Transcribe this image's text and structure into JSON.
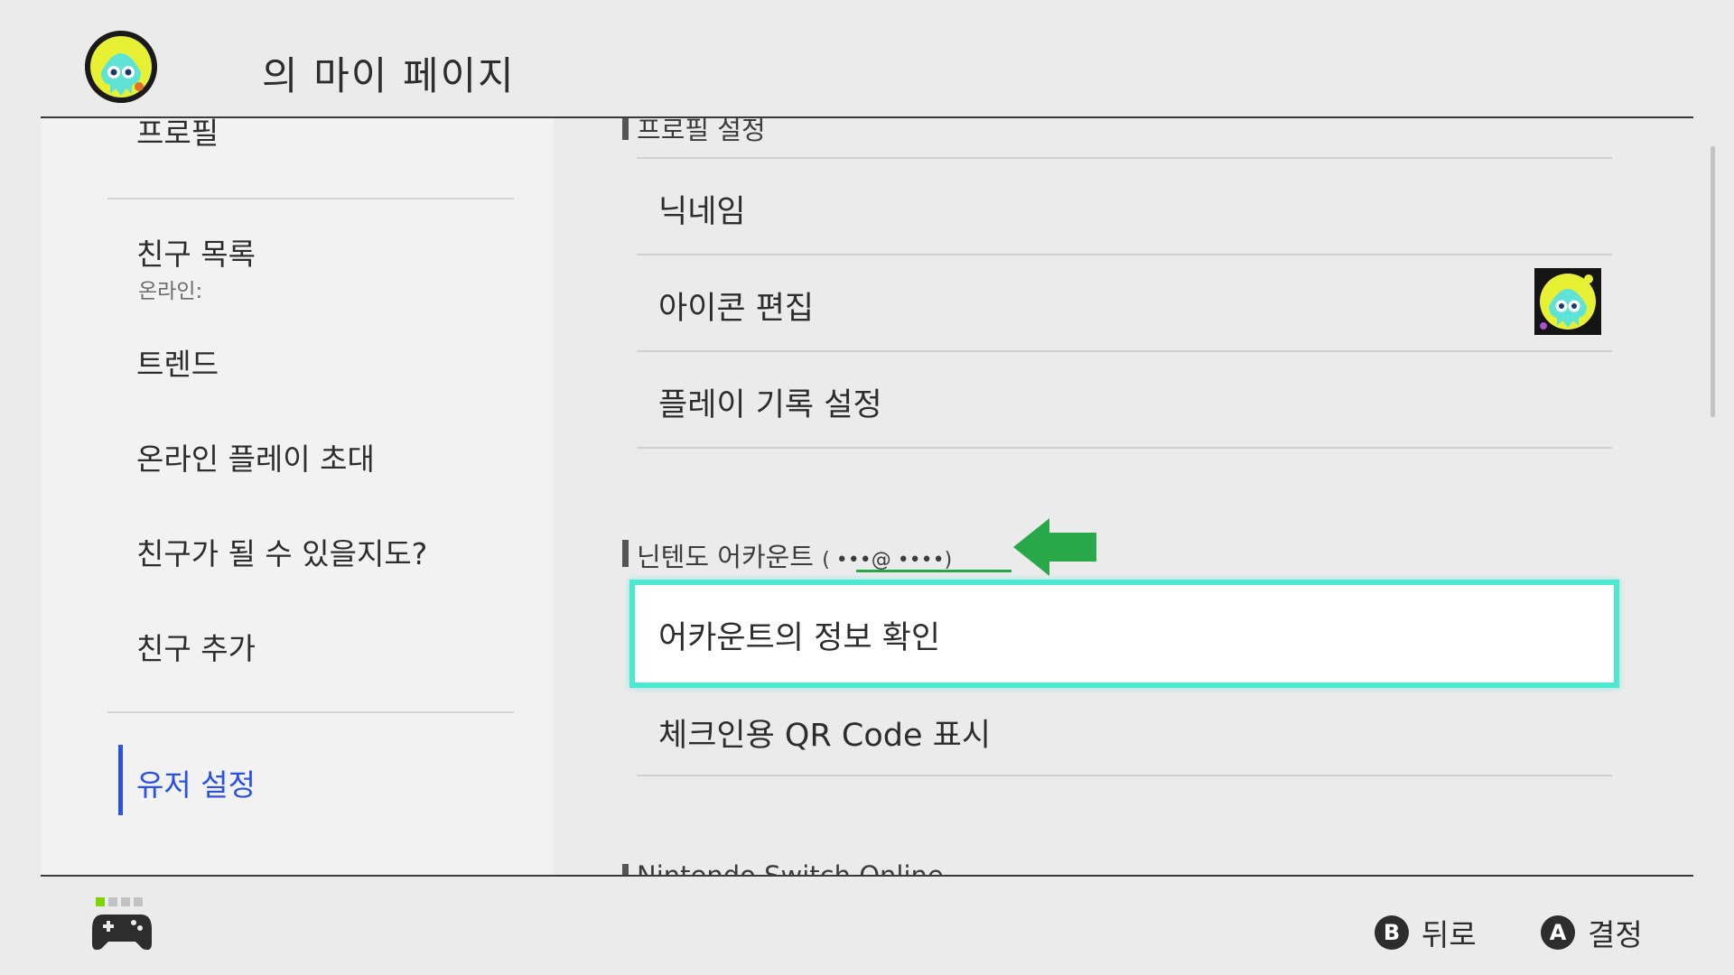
{
  "header": {
    "title": "의 마이 페이지"
  },
  "sidebar": {
    "items": [
      {
        "label": "프로필"
      },
      {
        "label": "친구 목록",
        "sub": "온라인:"
      },
      {
        "label": "트렌드"
      },
      {
        "label": "온라인 플레이 초대"
      },
      {
        "label": "친구가 될 수 있을지도?"
      },
      {
        "label": "친구 추가"
      },
      {
        "label": "유저 설정",
        "active": true
      }
    ]
  },
  "content": {
    "profile_section": {
      "title": "프로필 설정",
      "rows": [
        {
          "label": "닉네임"
        },
        {
          "label": "아이콘 편집"
        },
        {
          "label": "플레이 기록 설정"
        }
      ]
    },
    "account_section": {
      "title": "닌텐도 어카운트",
      "email": "(    •••@  ••••)",
      "rows": [
        {
          "label": "어카운트의 정보 확인",
          "selected": true
        },
        {
          "label": "체크인용 QR Code 표시"
        }
      ]
    },
    "next_section": {
      "title": "Nintendo Switch Online"
    }
  },
  "footer": {
    "back": {
      "button": "B",
      "label": "뒤로"
    },
    "confirm": {
      "button": "A",
      "label": "결정"
    }
  },
  "colors": {
    "accent_blue": "#2b50e8",
    "selection_cyan": "#4ce8d2",
    "arrow_green": "#29a84a"
  }
}
